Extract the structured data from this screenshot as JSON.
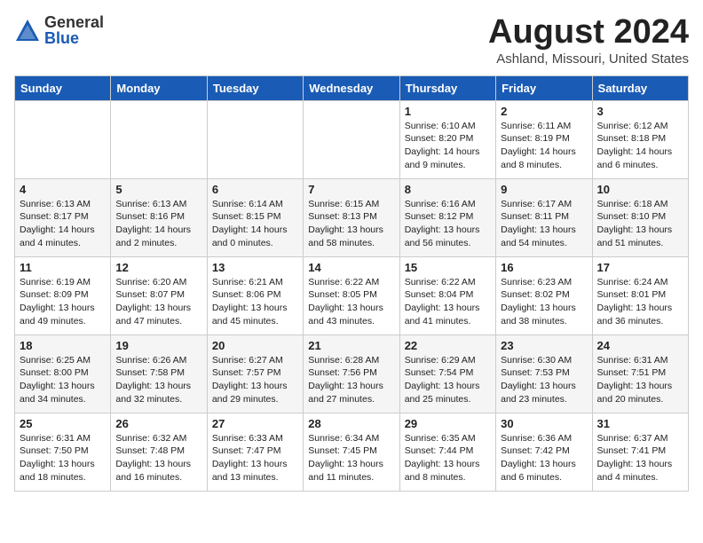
{
  "header": {
    "logo_general": "General",
    "logo_blue": "Blue",
    "month_title": "August 2024",
    "location": "Ashland, Missouri, United States"
  },
  "days_of_week": [
    "Sunday",
    "Monday",
    "Tuesday",
    "Wednesday",
    "Thursday",
    "Friday",
    "Saturday"
  ],
  "weeks": [
    [
      {
        "day": "",
        "info": ""
      },
      {
        "day": "",
        "info": ""
      },
      {
        "day": "",
        "info": ""
      },
      {
        "day": "",
        "info": ""
      },
      {
        "day": "1",
        "info": "Sunrise: 6:10 AM\nSunset: 8:20 PM\nDaylight: 14 hours\nand 9 minutes."
      },
      {
        "day": "2",
        "info": "Sunrise: 6:11 AM\nSunset: 8:19 PM\nDaylight: 14 hours\nand 8 minutes."
      },
      {
        "day": "3",
        "info": "Sunrise: 6:12 AM\nSunset: 8:18 PM\nDaylight: 14 hours\nand 6 minutes."
      }
    ],
    [
      {
        "day": "4",
        "info": "Sunrise: 6:13 AM\nSunset: 8:17 PM\nDaylight: 14 hours\nand 4 minutes."
      },
      {
        "day": "5",
        "info": "Sunrise: 6:13 AM\nSunset: 8:16 PM\nDaylight: 14 hours\nand 2 minutes."
      },
      {
        "day": "6",
        "info": "Sunrise: 6:14 AM\nSunset: 8:15 PM\nDaylight: 14 hours\nand 0 minutes."
      },
      {
        "day": "7",
        "info": "Sunrise: 6:15 AM\nSunset: 8:13 PM\nDaylight: 13 hours\nand 58 minutes."
      },
      {
        "day": "8",
        "info": "Sunrise: 6:16 AM\nSunset: 8:12 PM\nDaylight: 13 hours\nand 56 minutes."
      },
      {
        "day": "9",
        "info": "Sunrise: 6:17 AM\nSunset: 8:11 PM\nDaylight: 13 hours\nand 54 minutes."
      },
      {
        "day": "10",
        "info": "Sunrise: 6:18 AM\nSunset: 8:10 PM\nDaylight: 13 hours\nand 51 minutes."
      }
    ],
    [
      {
        "day": "11",
        "info": "Sunrise: 6:19 AM\nSunset: 8:09 PM\nDaylight: 13 hours\nand 49 minutes."
      },
      {
        "day": "12",
        "info": "Sunrise: 6:20 AM\nSunset: 8:07 PM\nDaylight: 13 hours\nand 47 minutes."
      },
      {
        "day": "13",
        "info": "Sunrise: 6:21 AM\nSunset: 8:06 PM\nDaylight: 13 hours\nand 45 minutes."
      },
      {
        "day": "14",
        "info": "Sunrise: 6:22 AM\nSunset: 8:05 PM\nDaylight: 13 hours\nand 43 minutes."
      },
      {
        "day": "15",
        "info": "Sunrise: 6:22 AM\nSunset: 8:04 PM\nDaylight: 13 hours\nand 41 minutes."
      },
      {
        "day": "16",
        "info": "Sunrise: 6:23 AM\nSunset: 8:02 PM\nDaylight: 13 hours\nand 38 minutes."
      },
      {
        "day": "17",
        "info": "Sunrise: 6:24 AM\nSunset: 8:01 PM\nDaylight: 13 hours\nand 36 minutes."
      }
    ],
    [
      {
        "day": "18",
        "info": "Sunrise: 6:25 AM\nSunset: 8:00 PM\nDaylight: 13 hours\nand 34 minutes."
      },
      {
        "day": "19",
        "info": "Sunrise: 6:26 AM\nSunset: 7:58 PM\nDaylight: 13 hours\nand 32 minutes."
      },
      {
        "day": "20",
        "info": "Sunrise: 6:27 AM\nSunset: 7:57 PM\nDaylight: 13 hours\nand 29 minutes."
      },
      {
        "day": "21",
        "info": "Sunrise: 6:28 AM\nSunset: 7:56 PM\nDaylight: 13 hours\nand 27 minutes."
      },
      {
        "day": "22",
        "info": "Sunrise: 6:29 AM\nSunset: 7:54 PM\nDaylight: 13 hours\nand 25 minutes."
      },
      {
        "day": "23",
        "info": "Sunrise: 6:30 AM\nSunset: 7:53 PM\nDaylight: 13 hours\nand 23 minutes."
      },
      {
        "day": "24",
        "info": "Sunrise: 6:31 AM\nSunset: 7:51 PM\nDaylight: 13 hours\nand 20 minutes."
      }
    ],
    [
      {
        "day": "25",
        "info": "Sunrise: 6:31 AM\nSunset: 7:50 PM\nDaylight: 13 hours\nand 18 minutes."
      },
      {
        "day": "26",
        "info": "Sunrise: 6:32 AM\nSunset: 7:48 PM\nDaylight: 13 hours\nand 16 minutes."
      },
      {
        "day": "27",
        "info": "Sunrise: 6:33 AM\nSunset: 7:47 PM\nDaylight: 13 hours\nand 13 minutes."
      },
      {
        "day": "28",
        "info": "Sunrise: 6:34 AM\nSunset: 7:45 PM\nDaylight: 13 hours\nand 11 minutes."
      },
      {
        "day": "29",
        "info": "Sunrise: 6:35 AM\nSunset: 7:44 PM\nDaylight: 13 hours\nand 8 minutes."
      },
      {
        "day": "30",
        "info": "Sunrise: 6:36 AM\nSunset: 7:42 PM\nDaylight: 13 hours\nand 6 minutes."
      },
      {
        "day": "31",
        "info": "Sunrise: 6:37 AM\nSunset: 7:41 PM\nDaylight: 13 hours\nand 4 minutes."
      }
    ]
  ]
}
